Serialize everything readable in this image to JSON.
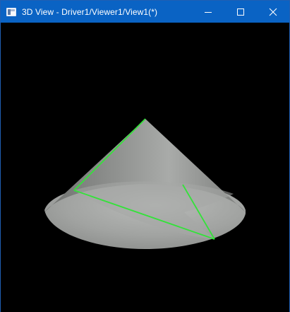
{
  "window": {
    "title": "3D View - Driver1/Viewer1/View1(*)",
    "icon": "app-window-icon",
    "controls": [
      "minimize-icon",
      "maximize-icon",
      "close-icon"
    ]
  },
  "viewport": {
    "background": "#000000",
    "object": "cone",
    "shading_color": "#a6a8a6",
    "edge_highlight_color": "#34e23a"
  },
  "colors": {
    "titlebar": "#0a63c4",
    "title_text": "#ffffff"
  }
}
